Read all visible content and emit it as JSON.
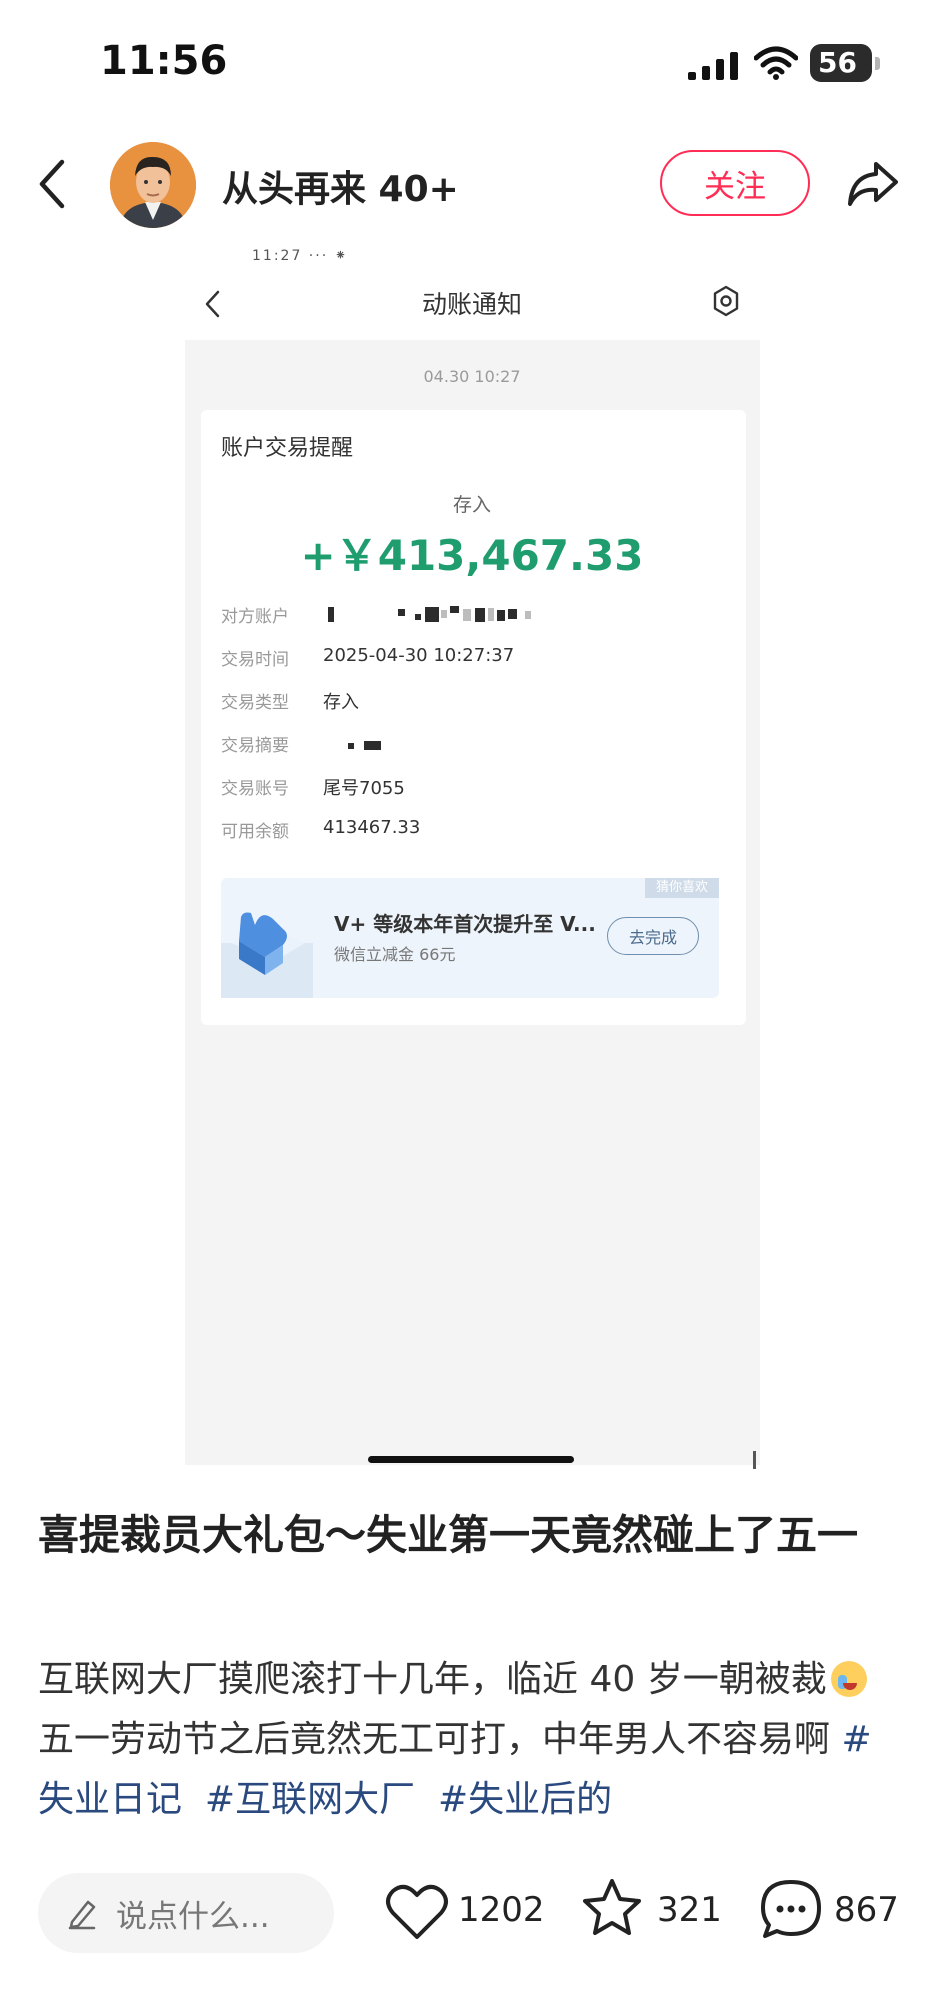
{
  "status_bar": {
    "time": "11:56",
    "battery": "56"
  },
  "header": {
    "author": "从头再来 40+",
    "follow_label": "关注"
  },
  "screenshot": {
    "top_residue": "11:27  ···  ⁕",
    "title": "动账通知",
    "date": "04.30 10:27",
    "card_title": "账户交易提醒",
    "deposit_label": "存入",
    "amount": "+￥413,467.33",
    "rows": [
      {
        "label": "对方账户",
        "value": ""
      },
      {
        "label": "交易时间",
        "value": "2025-04-30 10:27:37"
      },
      {
        "label": "交易类型",
        "value": "存入"
      },
      {
        "label": "交易摘要",
        "value": ""
      },
      {
        "label": "交易账号",
        "value": "尾号7055"
      },
      {
        "label": "可用余额",
        "value": "413467.33"
      }
    ],
    "promo": {
      "tag": "猜你喜欢",
      "title": "V+ 等级本年首次提升至 V...",
      "subtitle": "微信立减金 66元",
      "button": "去完成"
    }
  },
  "post": {
    "title": "喜提裁员大礼包～失业第一天竟然碰上了五一",
    "body_part1": "互联网大厂摸爬滚打十几年，临近 40 岁一朝被裁",
    "body_part2": "五一劳动节之后竟然无工可打，中年男人不容易啊 ",
    "tags": [
      "#失业日记",
      "#互联网大厂",
      "#失业后的"
    ]
  },
  "bottom_bar": {
    "comment_placeholder": "说点什么...",
    "likes": "1202",
    "favorites": "321",
    "comments": "867"
  },
  "colors": {
    "accent": "#ff2d55",
    "amount": "#1f9d6f",
    "tag": "#2a4a7f"
  },
  "icons": [
    "back-arrow-icon",
    "share-icon",
    "gear-icon",
    "edit-icon",
    "heart-icon",
    "star-icon",
    "comment-bubble-icon"
  ]
}
